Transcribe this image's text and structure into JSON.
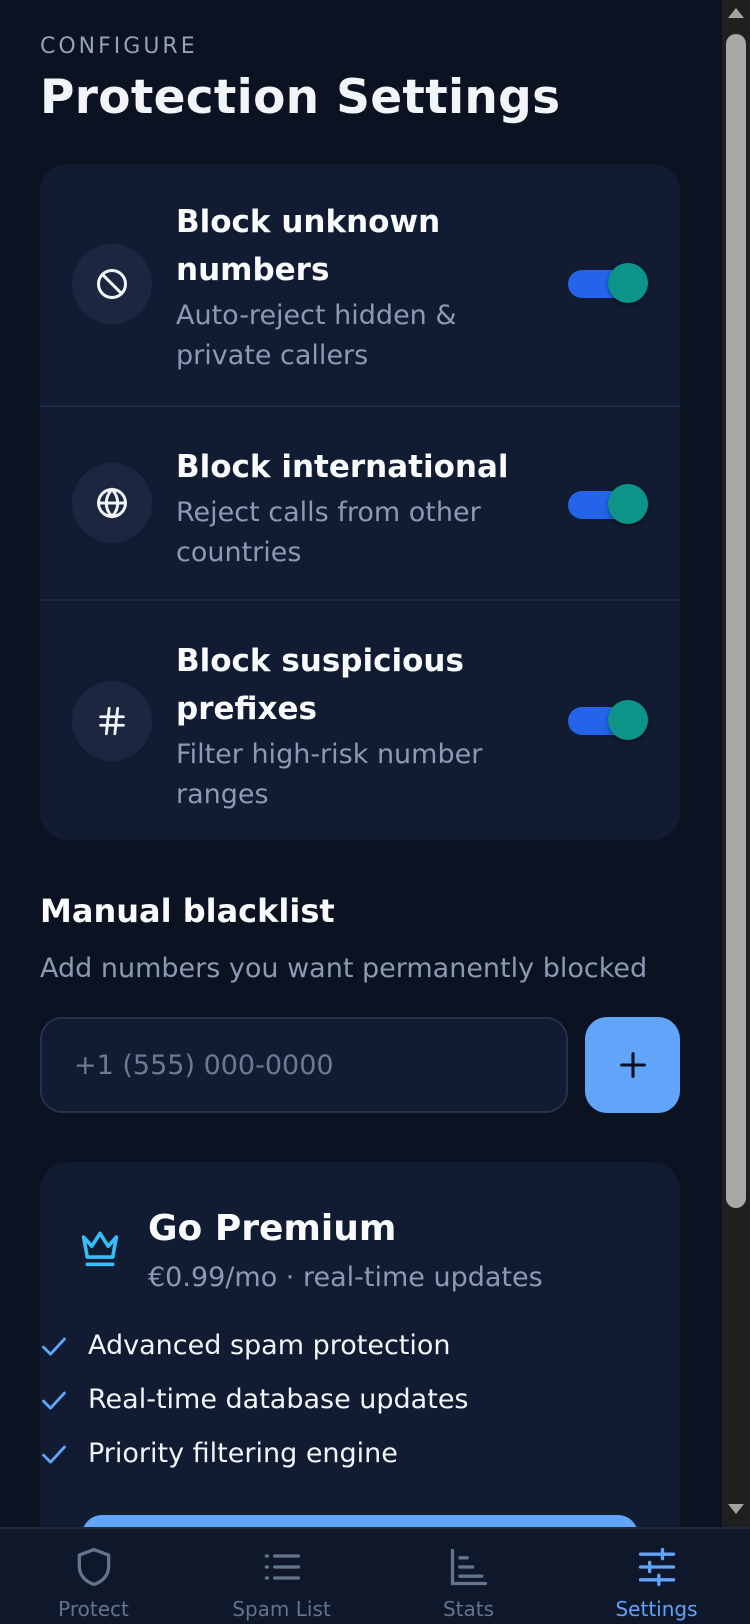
{
  "header": {
    "eyebrow": "CONFIGURE",
    "title": "Protection Settings"
  },
  "settings": [
    {
      "title": "Block unknown numbers",
      "description": "Auto-reject hidden & private callers",
      "icon": "block-icon",
      "enabled": true
    },
    {
      "title": "Block international",
      "description": "Reject calls from other countries",
      "icon": "globe-icon",
      "enabled": true
    },
    {
      "title": "Block suspicious prefixes",
      "description": "Filter high-risk number ranges",
      "icon": "hash-icon",
      "enabled": true
    }
  ],
  "blacklist": {
    "title": "Manual blacklist",
    "description": "Add numbers you want permanently blocked",
    "placeholder": "+1 (555) 000-0000",
    "value": ""
  },
  "premium": {
    "title": "Go Premium",
    "subtitle": "€0.99/mo · real-time updates",
    "features": [
      "Advanced spam protection",
      "Real-time database updates",
      "Priority filtering engine"
    ]
  },
  "nav": {
    "items": [
      {
        "label": "Protect",
        "icon": "shield-icon",
        "active": false
      },
      {
        "label": "Spam List",
        "icon": "list-icon",
        "active": false
      },
      {
        "label": "Stats",
        "icon": "bar-chart-icon",
        "active": false
      },
      {
        "label": "Settings",
        "icon": "sliders-icon",
        "active": true
      }
    ]
  },
  "colors": {
    "background": "#0b1221",
    "card": "#111c33",
    "accent": "#60a5fa",
    "toggle_track": "#2563eb",
    "toggle_knob": "#0d9488",
    "muted_text": "#8b9ab3"
  }
}
